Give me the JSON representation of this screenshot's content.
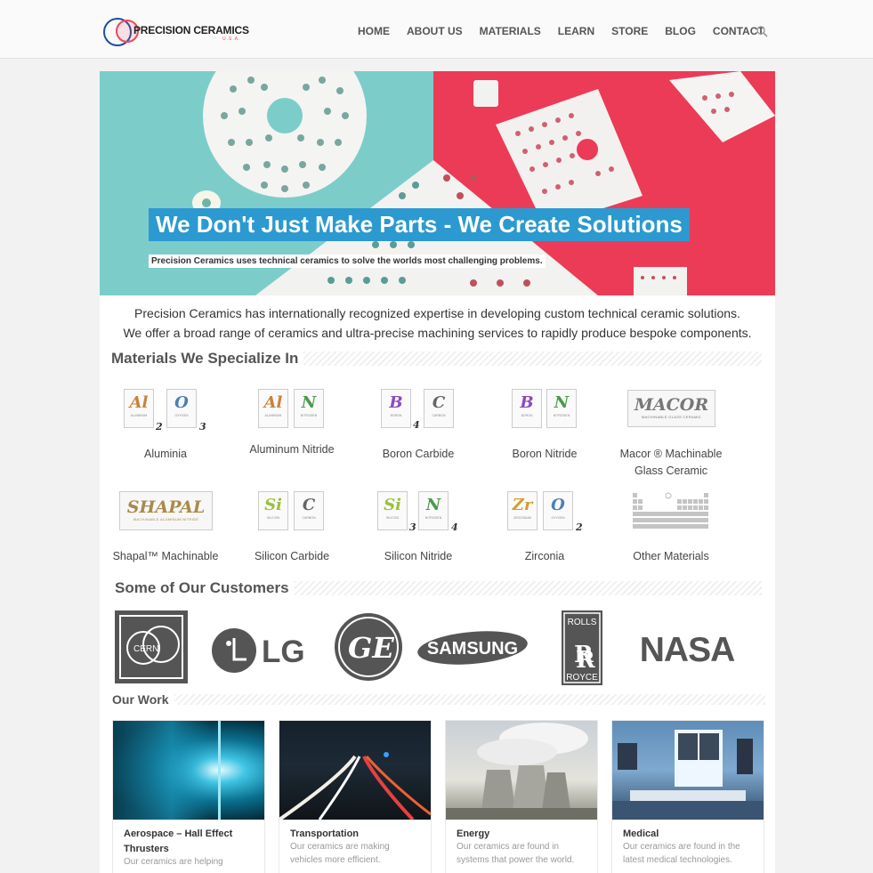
{
  "header": {
    "brand": "PRECISION CERAMICS",
    "brand_sub": "U.S.A.",
    "nav": [
      "HOME",
      "ABOUT US",
      "MATERIALS",
      "LEARN",
      "STORE",
      "BLOG",
      "CONTACT"
    ]
  },
  "hero": {
    "title": "We Don't Just Make Parts - We Create Solutions",
    "subtitle": "Precision Ceramics uses technical ceramics to solve the worlds most challenging problems."
  },
  "intro": {
    "line1": "Precision Ceramics has internationally recognized expertise in developing custom technical ceramic solutions.",
    "line2": "We offer a broad range of ceramics and ultra-precise machining services to rapidly produce bespoke components."
  },
  "materials": {
    "heading": "Materials We Specialize In",
    "items": [
      {
        "label": "Aluminia"
      },
      {
        "label": "Aluminum Nitride"
      },
      {
        "label": "Boron Carbide"
      },
      {
        "label": "Boron Nitride"
      },
      {
        "label": "Macor ® Machinable Glass Ceramic"
      },
      {
        "label": "Shapal™ Machinable"
      },
      {
        "label": "Silicon Carbide"
      },
      {
        "label": "Silicon Nitride"
      },
      {
        "label": "Zirconia"
      },
      {
        "label": "Other Materials"
      }
    ],
    "elements": {
      "Al": {
        "sym": "Al",
        "name": "ALUMINUM",
        "color": "#c8843a"
      },
      "O": {
        "sym": "O",
        "name": "OXYGEN",
        "color": "#4a7fb8"
      },
      "N": {
        "sym": "N",
        "name": "NITROGEN",
        "color": "#4a9a4a"
      },
      "B": {
        "sym": "B",
        "name": "BORON",
        "color": "#8a4ac0"
      },
      "C": {
        "sym": "C",
        "name": "CARBON",
        "color": "#666666"
      },
      "Si": {
        "sym": "Si",
        "name": "SILICON",
        "color": "#9ac040"
      },
      "Zr": {
        "sym": "Zr",
        "name": "ZIRCONIUM",
        "color": "#d0a030"
      }
    },
    "subscripts": {
      "two": "2",
      "three": "3",
      "four": "4"
    },
    "macor": {
      "big": "MACOR",
      "small": "MACHINABLE GLASS CERAMIC"
    },
    "shapal": {
      "big": "SHAPAL",
      "small": "MACHINABLE ALUMINUM NITRIDE"
    }
  },
  "customers": {
    "heading": "Some of Our Customers",
    "logos": [
      "CERN",
      "LG",
      "GE",
      "SAMSUNG",
      "ROLLS",
      "ROYCE",
      "NASA"
    ]
  },
  "work": {
    "heading": "Our Work",
    "cards": [
      {
        "title": "Aerospace – Hall Effect Thrusters",
        "desc": "Our ceramics are helping"
      },
      {
        "title": "Transportation",
        "desc": "Our ceramics are making vehicles more efficient."
      },
      {
        "title": "Energy",
        "desc": "Our ceramics are found in systems that power the world."
      },
      {
        "title": "Medical",
        "desc": "Our ceramics are found in the latest medical technologies."
      }
    ]
  }
}
